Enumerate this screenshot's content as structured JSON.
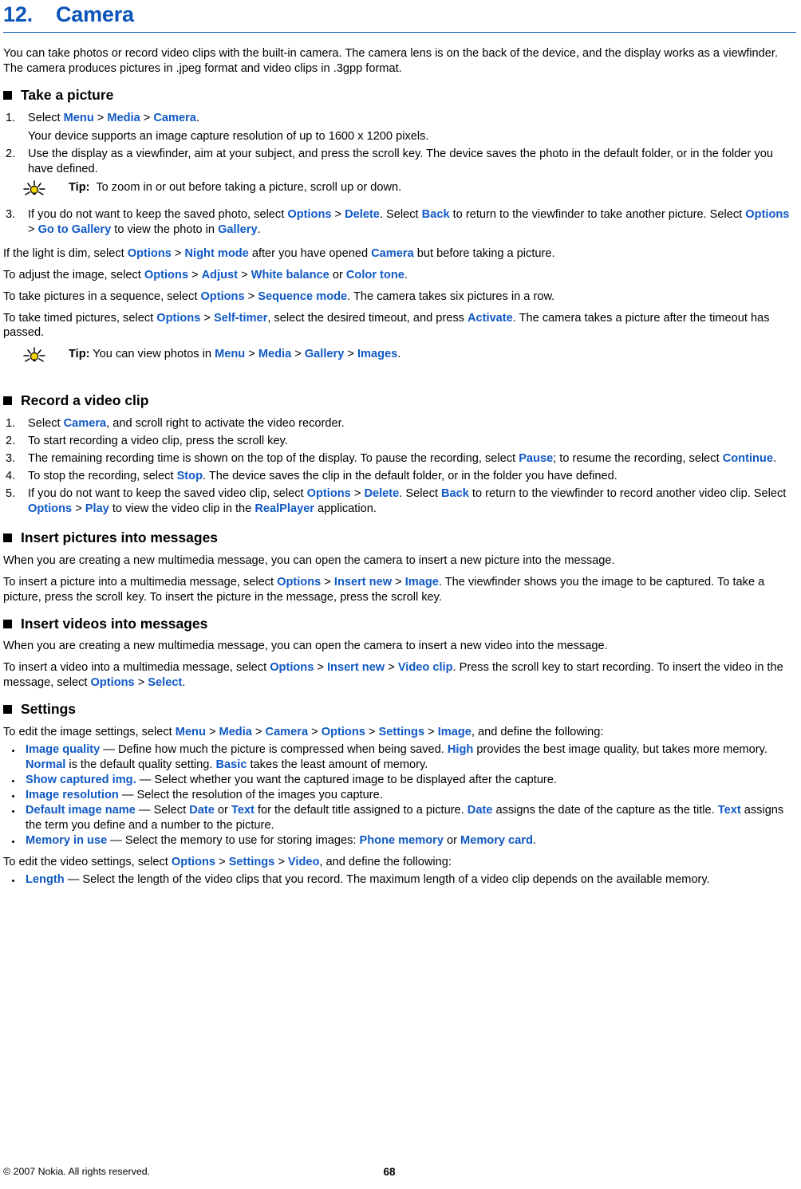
{
  "header": {
    "number": "12.",
    "title": "Camera"
  },
  "intro": "You can take photos or record video clips with the built-in camera. The camera lens is on the back of the device, and the display works as a viewfinder. The camera produces pictures in .jpeg format and video clips in .3gpp format.",
  "sections": {
    "take_picture": {
      "heading": "Take a picture",
      "step1_pre": "Select ",
      "step1_menu": "Menu",
      "step1_media": "Media",
      "step1_camera": "Camera",
      "step1_post": ".",
      "step1_sub": "Your device supports an image capture resolution of up to 1600 x 1200 pixels.",
      "step2": "Use the display as a viewfinder, aim at your subject, and press the scroll key. The device saves the photo in the default folder, or in the folder you have defined.",
      "tip1_label": "Tip:",
      "tip1_text": "To zoom in or out before taking a picture, scroll up or down.",
      "step3_a": "If you do not want to keep the saved photo, select ",
      "step3_options1": "Options",
      "step3_delete": "Delete",
      "step3_b": ". Select ",
      "step3_back": "Back",
      "step3_c": " to return to the viewfinder to take another picture. Select ",
      "step3_options2": "Options",
      "step3_gotogallery": "Go to Gallery",
      "step3_d": " to view the photo in ",
      "step3_gallery": "Gallery",
      "step3_e": ".",
      "p_night_a": "If the light is dim, select ",
      "p_night_options": "Options",
      "p_night_mode": "Night mode",
      "p_night_b": " after you have opened ",
      "p_night_camera": "Camera",
      "p_night_c": " but before taking a picture.",
      "p_adjust_a": "To adjust the image, select ",
      "p_adjust_options": "Options",
      "p_adjust_adjust": "Adjust",
      "p_adjust_white": "White balance",
      "p_adjust_b": " or ",
      "p_adjust_color": "Color tone",
      "p_adjust_c": ".",
      "p_seq_a": "To take pictures in a sequence, select ",
      "p_seq_options": "Options",
      "p_seq_mode": "Sequence mode",
      "p_seq_b": ". The camera takes six pictures in a row.",
      "p_timer_a": "To take timed pictures, select ",
      "p_timer_options": "Options",
      "p_timer_self": "Self-timer",
      "p_timer_b": ", select the desired timeout, and press ",
      "p_timer_activate": "Activate",
      "p_timer_c": ". The camera takes a picture after the timeout has passed.",
      "tip2_label": "Tip:",
      "tip2_a": " You can view photos in ",
      "tip2_menu": "Menu",
      "tip2_media": "Media",
      "tip2_gallery": "Gallery",
      "tip2_images": "Images",
      "tip2_b": "."
    },
    "record_video": {
      "heading": "Record a video clip",
      "step1_a": "Select ",
      "step1_camera": "Camera",
      "step1_b": ", and scroll right to activate the video recorder.",
      "step2": "To start recording a video clip, press the scroll key.",
      "step3_a": "The remaining recording time is shown on the top of the display. To pause the recording, select ",
      "step3_pause": "Pause",
      "step3_b": "; to resume the recording, select ",
      "step3_continue": "Continue",
      "step3_c": ".",
      "step4_a": "To stop the recording, select ",
      "step4_stop": "Stop",
      "step4_b": ". The device saves the clip in the default folder, or in the folder you have defined.",
      "step5_a": "If you do not want to keep the saved video clip, select ",
      "step5_options1": "Options",
      "step5_delete": "Delete",
      "step5_b": ". Select ",
      "step5_back": "Back",
      "step5_c": " to return to the viewfinder to record another video clip. Select ",
      "step5_options2": "Options",
      "step5_play": "Play",
      "step5_d": " to view the video clip in the ",
      "step5_realplayer": "RealPlayer",
      "step5_e": " application."
    },
    "insert_pictures": {
      "heading": "Insert pictures into messages",
      "p1": "When you are creating a new multimedia message, you can open the camera to insert a new picture into the message.",
      "p2_a": "To insert a picture into a multimedia message, select ",
      "p2_options": "Options",
      "p2_insertnew": "Insert new",
      "p2_image": "Image",
      "p2_b": ". The viewfinder shows you the image to be captured. To take a picture, press the scroll key. To insert the picture in the message, press the scroll key."
    },
    "insert_videos": {
      "heading": "Insert videos into messages",
      "p1": "When you are creating a new multimedia message, you can open the camera to insert a new video into the message.",
      "p2_a": "To insert a video into a multimedia message, select ",
      "p2_options": "Options",
      "p2_insertnew": "Insert new",
      "p2_videoclip": "Video clip",
      "p2_b": ". Press the scroll key to start recording. To insert the video in the message, select ",
      "p2_options2": "Options",
      "p2_select": "Select",
      "p2_c": "."
    },
    "settings": {
      "heading": "Settings",
      "image_intro_a": "To edit the image settings, select ",
      "image_intro_menu": "Menu",
      "image_intro_media": "Media",
      "image_intro_camera": "Camera",
      "image_intro_options": "Options",
      "image_intro_settings": "Settings",
      "image_intro_image": "Image",
      "image_intro_b": ", and define the following:",
      "items": [
        {
          "term": "Image quality",
          "dash": " — ",
          "text_a": "Define how much the picture is compressed when being saved. ",
          "link_high": "High",
          "text_b": " provides the best image quality, but takes more memory. ",
          "link_normal": "Normal",
          "text_c": " is the default quality setting. ",
          "link_basic": "Basic",
          "text_d": " takes the least amount of memory."
        },
        {
          "term": "Show captured img.",
          "dash": " — ",
          "text_a": "Select whether you want the captured image to be displayed after the capture."
        },
        {
          "term": "Image resolution",
          "dash": " — ",
          "text_a": "Select the resolution of the images you capture."
        },
        {
          "term": "Default image name",
          "dash": " — ",
          "text_a": "Select ",
          "link_date": "Date",
          "text_b": " or ",
          "link_text": "Text",
          "text_c": " for the default title assigned to a picture. ",
          "link_date2": "Date",
          "text_d": " assigns the date of the capture as the title. ",
          "link_text2": "Text",
          "text_e": " assigns the term you define and a number to the picture."
        },
        {
          "term": "Memory in use",
          "dash": " — ",
          "text_a": "Select the memory to use for storing images: ",
          "link_phone": "Phone memory",
          "text_b": " or ",
          "link_card": "Memory card",
          "text_c": "."
        }
      ],
      "video_intro_a": "To edit the video settings, select ",
      "video_intro_options": "Options",
      "video_intro_settings": "Settings",
      "video_intro_video": "Video",
      "video_intro_b": ", and define the following:",
      "video_items": [
        {
          "term": "Length",
          "dash": " — ",
          "text_a": "Select the length of the video clips that you record. The maximum length of a video clip depends on the available memory."
        }
      ]
    }
  },
  "footer": {
    "copyright": "© 2007 Nokia. All rights reserved.",
    "page_number": "68"
  },
  "separator": ">",
  "colors": {
    "link_blue": "#1059C4",
    "title_blue": "#0B54B8",
    "tip_bulb": "#F5D500"
  }
}
